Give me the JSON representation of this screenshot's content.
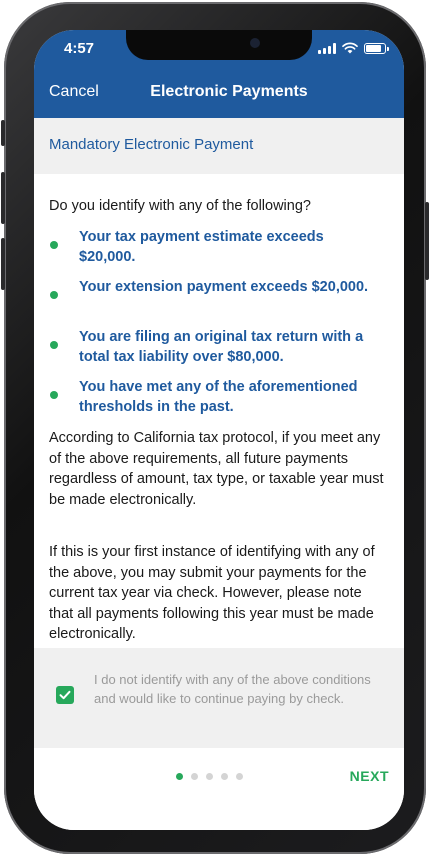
{
  "status_bar": {
    "time": "4:57"
  },
  "nav": {
    "cancel_label": "Cancel",
    "title": "Electronic Payments"
  },
  "section": {
    "title": "Mandatory Electronic Payment"
  },
  "content": {
    "question": "Do you identify with any of the following?",
    "requirements": [
      "Your tax payment estimate exceeds $20,000.",
      "Your extension payment exceeds $20,000.",
      "You are filing an original tax return with a total tax liability over $80,000.",
      "You have met any of the aforementioned thresholds in the past."
    ],
    "paragraph_1": "According to California tax protocol, if you meet any of the above requirements, all future payments regardless of amount, tax type, or taxable year must be made electronically.",
    "paragraph_2": "If this is your first instance of identifying with any of the above, you may submit your payments for the current tax year via check. However, please note that all payments following this year must be made electronically."
  },
  "confirm": {
    "checked": true,
    "label": "I do not identify with any of the above conditions and would like to continue paying by check."
  },
  "footer": {
    "page_count": 5,
    "active_page": 1,
    "next_label": "NEXT"
  },
  "colors": {
    "header_blue": "#1f5a9e",
    "accent_green": "#27a85b",
    "panel_gray": "#f0f0f0"
  },
  "icons": {
    "status": [
      "signal-icon",
      "wifi-icon",
      "battery-icon"
    ],
    "bullet": "green-dot-icon",
    "checkbox": "checkmark-icon"
  }
}
